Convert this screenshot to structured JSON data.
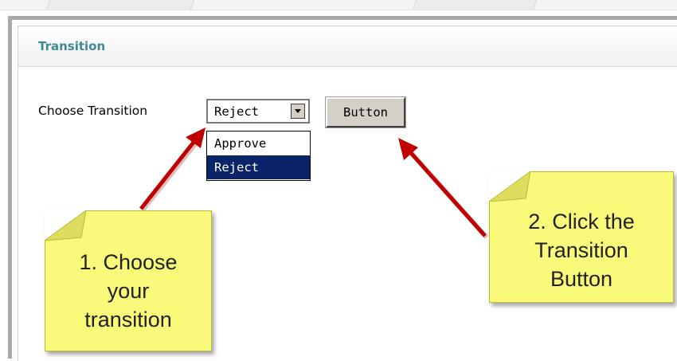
{
  "panel": {
    "title": "Transition"
  },
  "form": {
    "label": "Choose Transition",
    "select": {
      "selected": "Reject",
      "options": [
        "Approve",
        "Reject"
      ]
    },
    "button_label": "Button"
  },
  "callouts": [
    {
      "lines": [
        "1. Choose",
        "your",
        "transition"
      ]
    },
    {
      "lines": [
        "2. Click the",
        "Transition",
        "Button"
      ]
    }
  ],
  "colors": {
    "title": "#3b8a94",
    "note_fill": "#fafa7a",
    "arrow": "#c00000",
    "selection": "#0a246a"
  }
}
